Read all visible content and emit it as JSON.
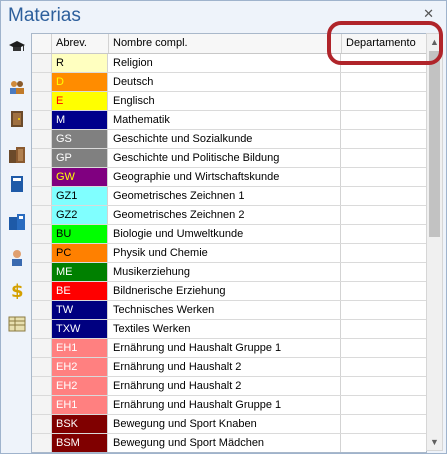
{
  "window": {
    "title": "Materias",
    "close_glyph": "✕"
  },
  "sidebar": {
    "buttons": [
      {
        "name": "graduation-cap-icon"
      },
      {
        "name": "people-icon"
      },
      {
        "name": "door-icon"
      },
      {
        "name": "doors-icon"
      },
      {
        "name": "book-icon"
      },
      {
        "name": "books-icon"
      },
      {
        "name": "person-icon"
      },
      {
        "name": "dollar-icon"
      },
      {
        "name": "table-icon"
      }
    ]
  },
  "grid": {
    "columns": {
      "abbrev": "Abrev.",
      "full_name": "Nombre compl.",
      "department": "Departamento"
    },
    "rows": [
      {
        "abbrev": "R",
        "name": "Religion",
        "bg": "#ffffc0",
        "fg": "#000000"
      },
      {
        "abbrev": "D",
        "name": "Deutsch",
        "bg": "#ff8c00",
        "fg": "#ffff00"
      },
      {
        "abbrev": "E",
        "name": "Englisch",
        "bg": "#ffff00",
        "fg": "#ff0000"
      },
      {
        "abbrev": "M",
        "name": "Mathematik",
        "bg": "#00008b",
        "fg": "#ffffff"
      },
      {
        "abbrev": "GS",
        "name": "Geschichte und Sozialkunde",
        "bg": "#808080",
        "fg": "#ffffff"
      },
      {
        "abbrev": "GP",
        "name": "Geschichte und Politische Bildung",
        "bg": "#808080",
        "fg": "#ffffff"
      },
      {
        "abbrev": "GW",
        "name": "Geographie und Wirtschaftskunde",
        "bg": "#800080",
        "fg": "#ffff00"
      },
      {
        "abbrev": "GZ1",
        "name": "Geometrisches Zeichnen 1",
        "bg": "#80ffff",
        "fg": "#000000"
      },
      {
        "abbrev": "GZ2",
        "name": "Geometrisches  Zeichnen 2",
        "bg": "#80ffff",
        "fg": "#000000"
      },
      {
        "abbrev": "BU",
        "name": "Biologie und Umweltkunde",
        "bg": "#00ff00",
        "fg": "#000000"
      },
      {
        "abbrev": "PC",
        "name": "Physik und Chemie",
        "bg": "#ff8000",
        "fg": "#000000"
      },
      {
        "abbrev": "ME",
        "name": "Musikerziehung",
        "bg": "#008000",
        "fg": "#ffffff"
      },
      {
        "abbrev": "BE",
        "name": "Bildnerische Erziehung",
        "bg": "#ff0000",
        "fg": "#ffffff"
      },
      {
        "abbrev": "TW",
        "name": "Technisches Werken",
        "bg": "#000080",
        "fg": "#ffffff"
      },
      {
        "abbrev": "TXW",
        "name": "Textiles Werken",
        "bg": "#000080",
        "fg": "#ffffff"
      },
      {
        "abbrev": "EH1",
        "name": "Ernährung und Haushalt Gruppe 1",
        "bg": "#ff8080",
        "fg": "#ffffff"
      },
      {
        "abbrev": "EH2",
        "name": "Ernährung und Haushalt 2",
        "bg": "#ff8080",
        "fg": "#ffffff"
      },
      {
        "abbrev": "EH2",
        "name": "Ernährung und Haushalt 2",
        "bg": "#ff8080",
        "fg": "#ffffff"
      },
      {
        "abbrev": "EH1",
        "name": "Ernährung und Haushalt Gruppe 1",
        "bg": "#ff8080",
        "fg": "#ffffff"
      },
      {
        "abbrev": "BSK",
        "name": "Bewegung und Sport  Knaben",
        "bg": "#800000",
        "fg": "#ffffff"
      },
      {
        "abbrev": "BSM",
        "name": "Bewegung und Sport Mädchen",
        "bg": "#800000",
        "fg": "#ffffff"
      }
    ]
  },
  "colors": {
    "highlight": "#b0242a",
    "title": "#2d5f9c"
  }
}
